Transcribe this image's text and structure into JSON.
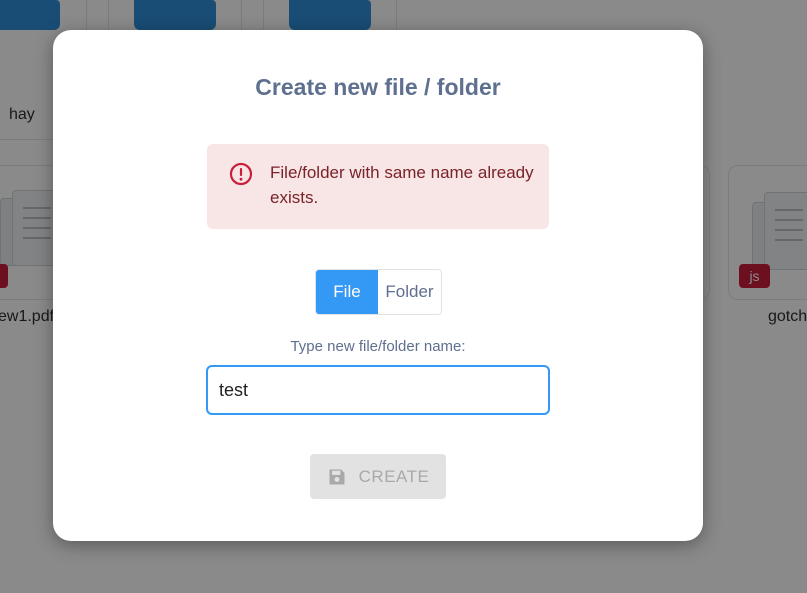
{
  "background": {
    "files": [
      {
        "label": "hay"
      },
      {
        "label": "ew1.pdf"
      },
      {
        "label": "gotch"
      }
    ],
    "badges": [
      "",
      "js"
    ]
  },
  "modal": {
    "title": "Create new file / folder",
    "alert": {
      "icon": "exclamation-circle-icon",
      "text": "File/folder with same name already exists.",
      "color": "#7a2229",
      "background": "#f8e6e6"
    },
    "type_toggle": {
      "options": [
        "File",
        "Folder"
      ],
      "selected": "File",
      "accent": "#3498f5"
    },
    "name_label": "Type new file/folder name:",
    "name_input": {
      "value": "test"
    },
    "create_button": {
      "label": "CREATE",
      "icon": "floppy-disk-icon",
      "disabled": true
    }
  }
}
